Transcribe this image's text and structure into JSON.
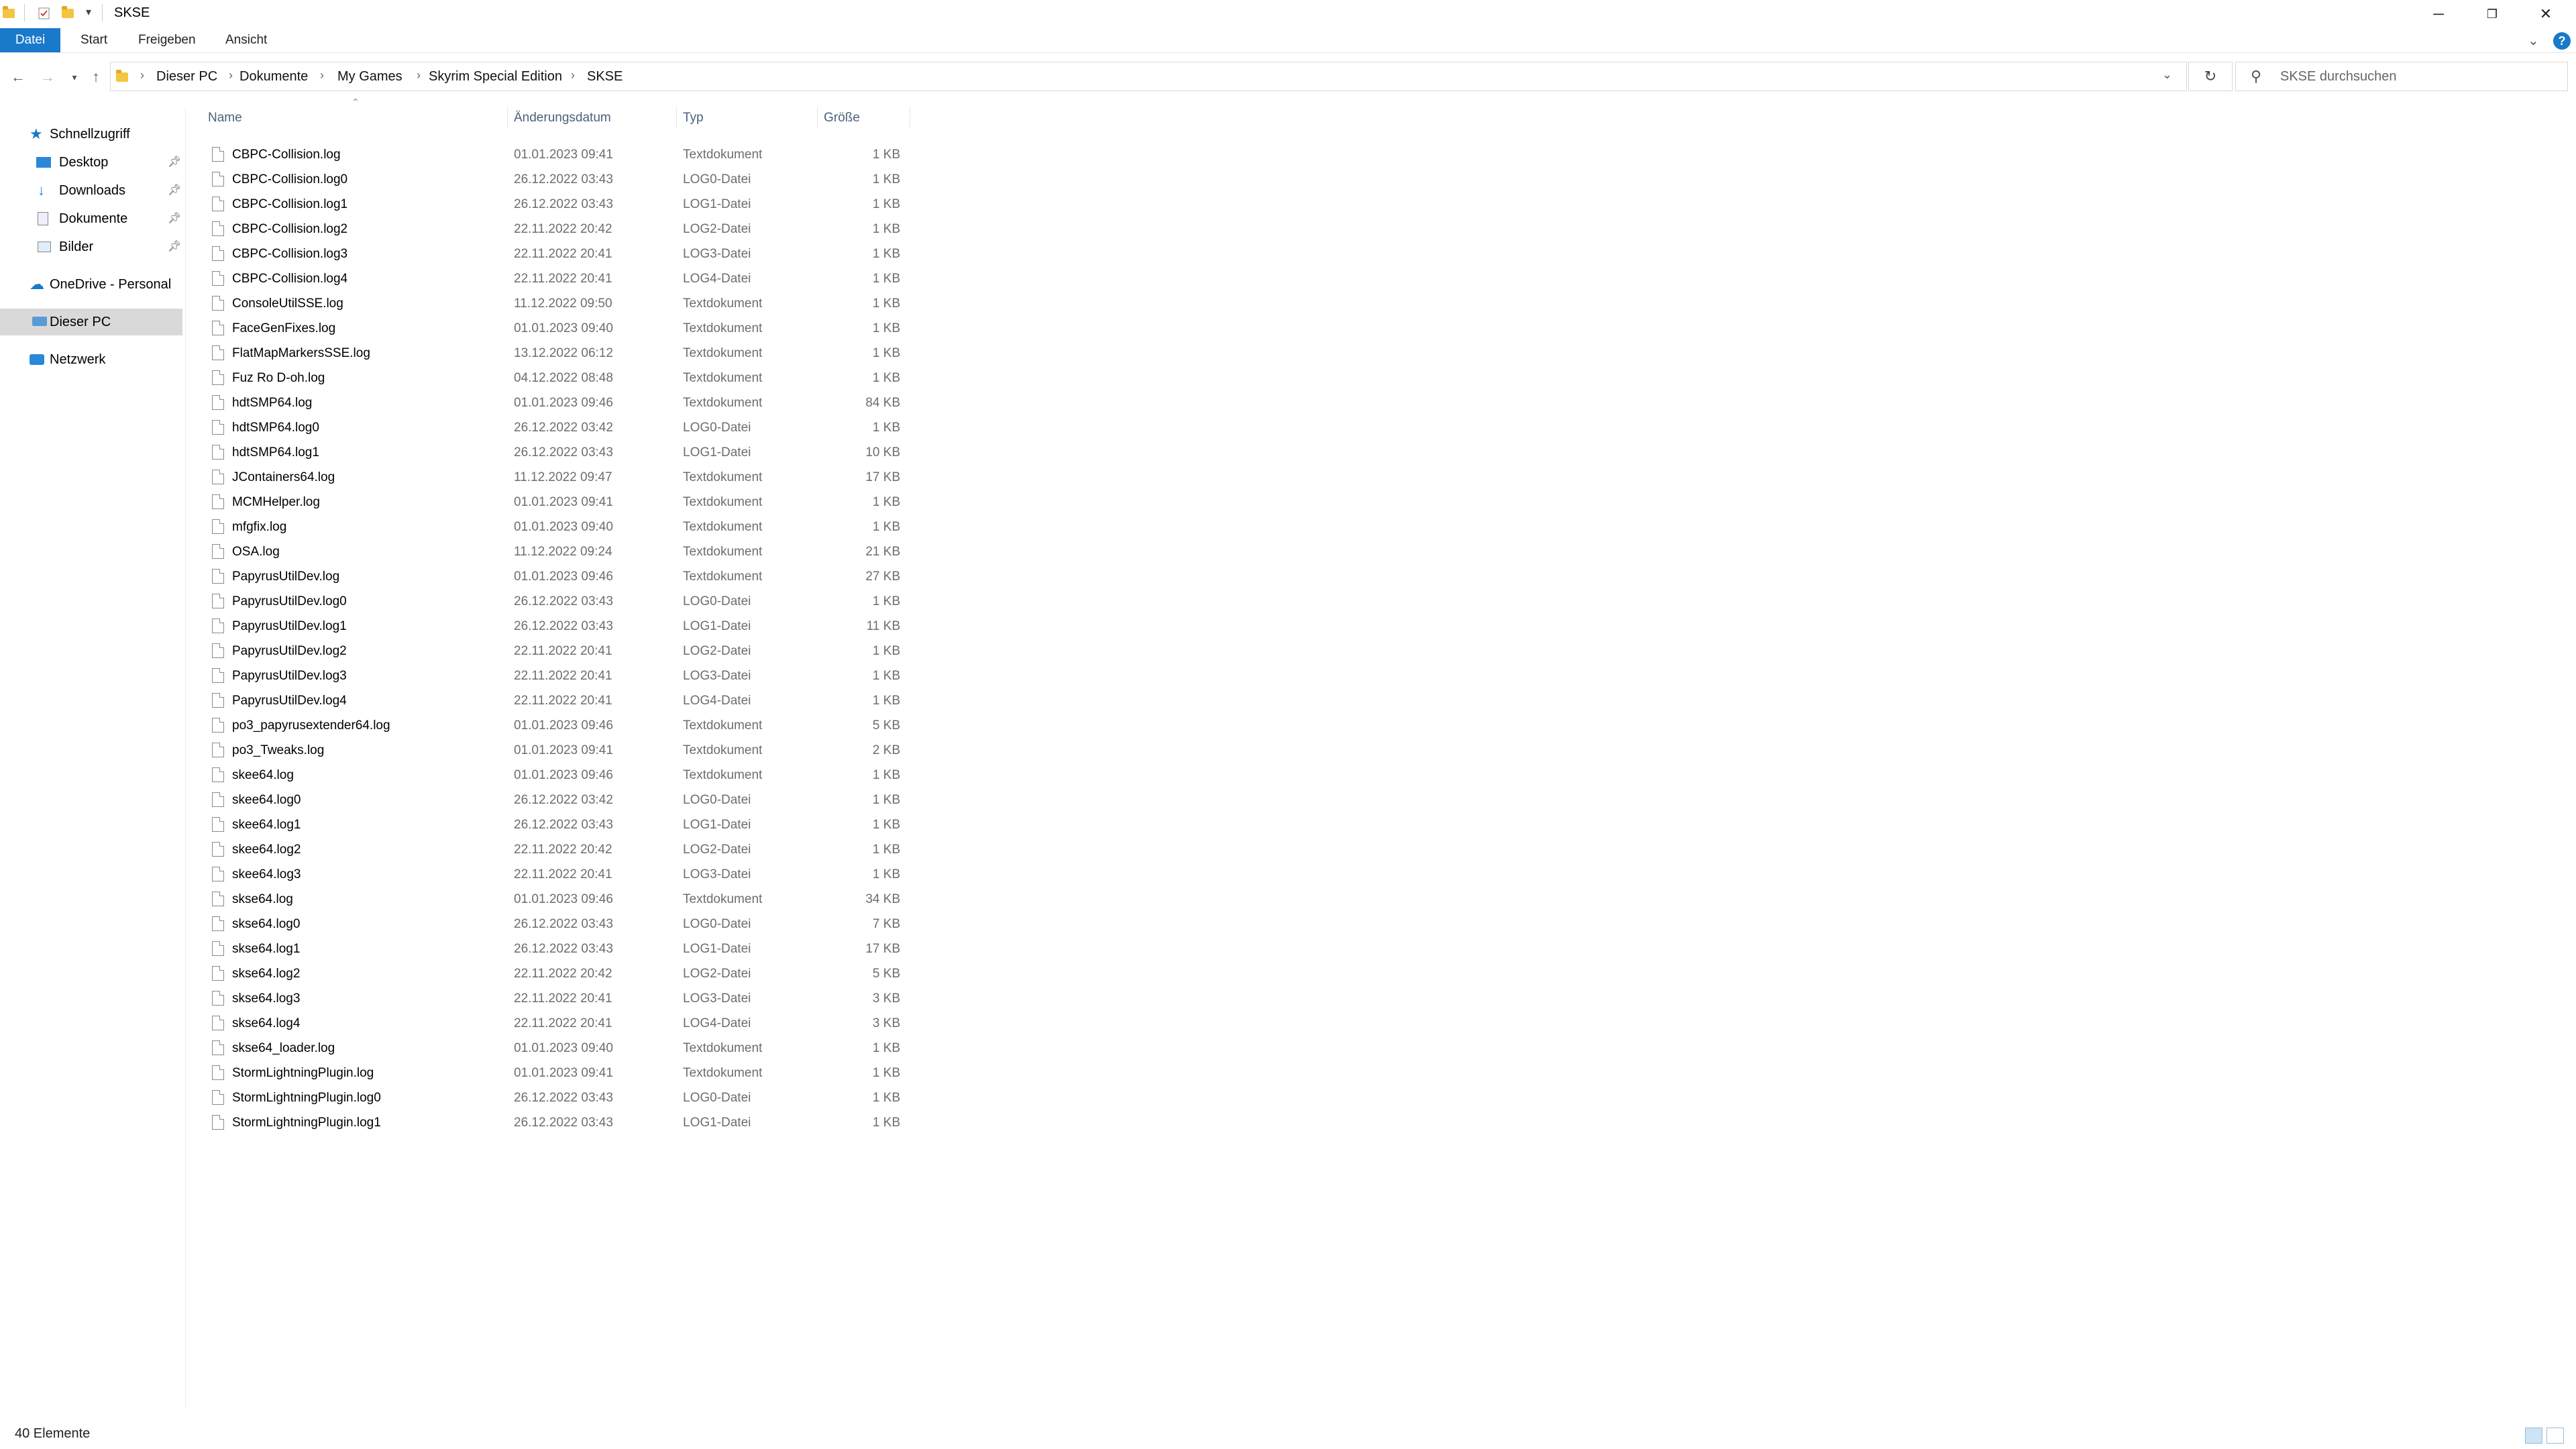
{
  "window": {
    "title": "SKSE",
    "controls": [
      "minimize",
      "restore",
      "close"
    ]
  },
  "ribbon": {
    "tabs": [
      "Datei",
      "Start",
      "Freigeben",
      "Ansicht"
    ],
    "active_tab": "Datei",
    "accent_color": "#1979ca"
  },
  "address": {
    "crumbs": [
      "Dieser PC",
      "Dokumente",
      "My Games",
      "Skyrim Special Edition",
      "SKSE"
    ]
  },
  "search": {
    "placeholder": "SKSE durchsuchen"
  },
  "navpane": {
    "quick_access": "Schnellzugriff",
    "pinned": [
      {
        "label": "Desktop",
        "icon": "desktop-icon"
      },
      {
        "label": "Downloads",
        "icon": "download-icon"
      },
      {
        "label": "Dokumente",
        "icon": "documents-icon"
      },
      {
        "label": "Bilder",
        "icon": "pictures-icon"
      }
    ],
    "onedrive": "OneDrive - Personal",
    "this_pc": "Dieser PC",
    "network": "Netzwerk",
    "selected": "Dieser PC"
  },
  "filelist": {
    "columns": [
      "Name",
      "Änderungsdatum",
      "Typ",
      "Größe"
    ],
    "files": [
      {
        "name": "CBPC-Collision.log",
        "date": "01.01.2023 09:41",
        "type": "Textdokument",
        "size": "1 KB"
      },
      {
        "name": "CBPC-Collision.log0",
        "date": "26.12.2022 03:43",
        "type": "LOG0-Datei",
        "size": "1 KB"
      },
      {
        "name": "CBPC-Collision.log1",
        "date": "26.12.2022 03:43",
        "type": "LOG1-Datei",
        "size": "1 KB"
      },
      {
        "name": "CBPC-Collision.log2",
        "date": "22.11.2022 20:42",
        "type": "LOG2-Datei",
        "size": "1 KB"
      },
      {
        "name": "CBPC-Collision.log3",
        "date": "22.11.2022 20:41",
        "type": "LOG3-Datei",
        "size": "1 KB"
      },
      {
        "name": "CBPC-Collision.log4",
        "date": "22.11.2022 20:41",
        "type": "LOG4-Datei",
        "size": "1 KB"
      },
      {
        "name": "ConsoleUtilSSE.log",
        "date": "11.12.2022 09:50",
        "type": "Textdokument",
        "size": "1 KB"
      },
      {
        "name": "FaceGenFixes.log",
        "date": "01.01.2023 09:40",
        "type": "Textdokument",
        "size": "1 KB"
      },
      {
        "name": "FlatMapMarkersSSE.log",
        "date": "13.12.2022 06:12",
        "type": "Textdokument",
        "size": "1 KB"
      },
      {
        "name": "Fuz Ro D-oh.log",
        "date": "04.12.2022 08:48",
        "type": "Textdokument",
        "size": "1 KB"
      },
      {
        "name": "hdtSMP64.log",
        "date": "01.01.2023 09:46",
        "type": "Textdokument",
        "size": "84 KB"
      },
      {
        "name": "hdtSMP64.log0",
        "date": "26.12.2022 03:42",
        "type": "LOG0-Datei",
        "size": "1 KB"
      },
      {
        "name": "hdtSMP64.log1",
        "date": "26.12.2022 03:43",
        "type": "LOG1-Datei",
        "size": "10 KB"
      },
      {
        "name": "JContainers64.log",
        "date": "11.12.2022 09:47",
        "type": "Textdokument",
        "size": "17 KB"
      },
      {
        "name": "MCMHelper.log",
        "date": "01.01.2023 09:41",
        "type": "Textdokument",
        "size": "1 KB"
      },
      {
        "name": "mfgfix.log",
        "date": "01.01.2023 09:40",
        "type": "Textdokument",
        "size": "1 KB"
      },
      {
        "name": "OSA.log",
        "date": "11.12.2022 09:24",
        "type": "Textdokument",
        "size": "21 KB"
      },
      {
        "name": "PapyrusUtilDev.log",
        "date": "01.01.2023 09:46",
        "type": "Textdokument",
        "size": "27 KB"
      },
      {
        "name": "PapyrusUtilDev.log0",
        "date": "26.12.2022 03:43",
        "type": "LOG0-Datei",
        "size": "1 KB"
      },
      {
        "name": "PapyrusUtilDev.log1",
        "date": "26.12.2022 03:43",
        "type": "LOG1-Datei",
        "size": "11 KB"
      },
      {
        "name": "PapyrusUtilDev.log2",
        "date": "22.11.2022 20:41",
        "type": "LOG2-Datei",
        "size": "1 KB"
      },
      {
        "name": "PapyrusUtilDev.log3",
        "date": "22.11.2022 20:41",
        "type": "LOG3-Datei",
        "size": "1 KB"
      },
      {
        "name": "PapyrusUtilDev.log4",
        "date": "22.11.2022 20:41",
        "type": "LOG4-Datei",
        "size": "1 KB"
      },
      {
        "name": "po3_papyrusextender64.log",
        "date": "01.01.2023 09:46",
        "type": "Textdokument",
        "size": "5 KB"
      },
      {
        "name": "po3_Tweaks.log",
        "date": "01.01.2023 09:41",
        "type": "Textdokument",
        "size": "2 KB"
      },
      {
        "name": "skee64.log",
        "date": "01.01.2023 09:46",
        "type": "Textdokument",
        "size": "1 KB"
      },
      {
        "name": "skee64.log0",
        "date": "26.12.2022 03:42",
        "type": "LOG0-Datei",
        "size": "1 KB"
      },
      {
        "name": "skee64.log1",
        "date": "26.12.2022 03:43",
        "type": "LOG1-Datei",
        "size": "1 KB"
      },
      {
        "name": "skee64.log2",
        "date": "22.11.2022 20:42",
        "type": "LOG2-Datei",
        "size": "1 KB"
      },
      {
        "name": "skee64.log3",
        "date": "22.11.2022 20:41",
        "type": "LOG3-Datei",
        "size": "1 KB"
      },
      {
        "name": "skse64.log",
        "date": "01.01.2023 09:46",
        "type": "Textdokument",
        "size": "34 KB"
      },
      {
        "name": "skse64.log0",
        "date": "26.12.2022 03:43",
        "type": "LOG0-Datei",
        "size": "7 KB"
      },
      {
        "name": "skse64.log1",
        "date": "26.12.2022 03:43",
        "type": "LOG1-Datei",
        "size": "17 KB"
      },
      {
        "name": "skse64.log2",
        "date": "22.11.2022 20:42",
        "type": "LOG2-Datei",
        "size": "5 KB"
      },
      {
        "name": "skse64.log3",
        "date": "22.11.2022 20:41",
        "type": "LOG3-Datei",
        "size": "3 KB"
      },
      {
        "name": "skse64.log4",
        "date": "22.11.2022 20:41",
        "type": "LOG4-Datei",
        "size": "3 KB"
      },
      {
        "name": "skse64_loader.log",
        "date": "01.01.2023 09:40",
        "type": "Textdokument",
        "size": "1 KB"
      },
      {
        "name": "StormLightningPlugin.log",
        "date": "01.01.2023 09:41",
        "type": "Textdokument",
        "size": "1 KB"
      },
      {
        "name": "StormLightningPlugin.log0",
        "date": "26.12.2022 03:43",
        "type": "LOG0-Datei",
        "size": "1 KB"
      },
      {
        "name": "StormLightningPlugin.log1",
        "date": "26.12.2022 03:43",
        "type": "LOG1-Datei",
        "size": "1 KB"
      }
    ]
  },
  "status": {
    "item_count": "40 Elemente"
  }
}
